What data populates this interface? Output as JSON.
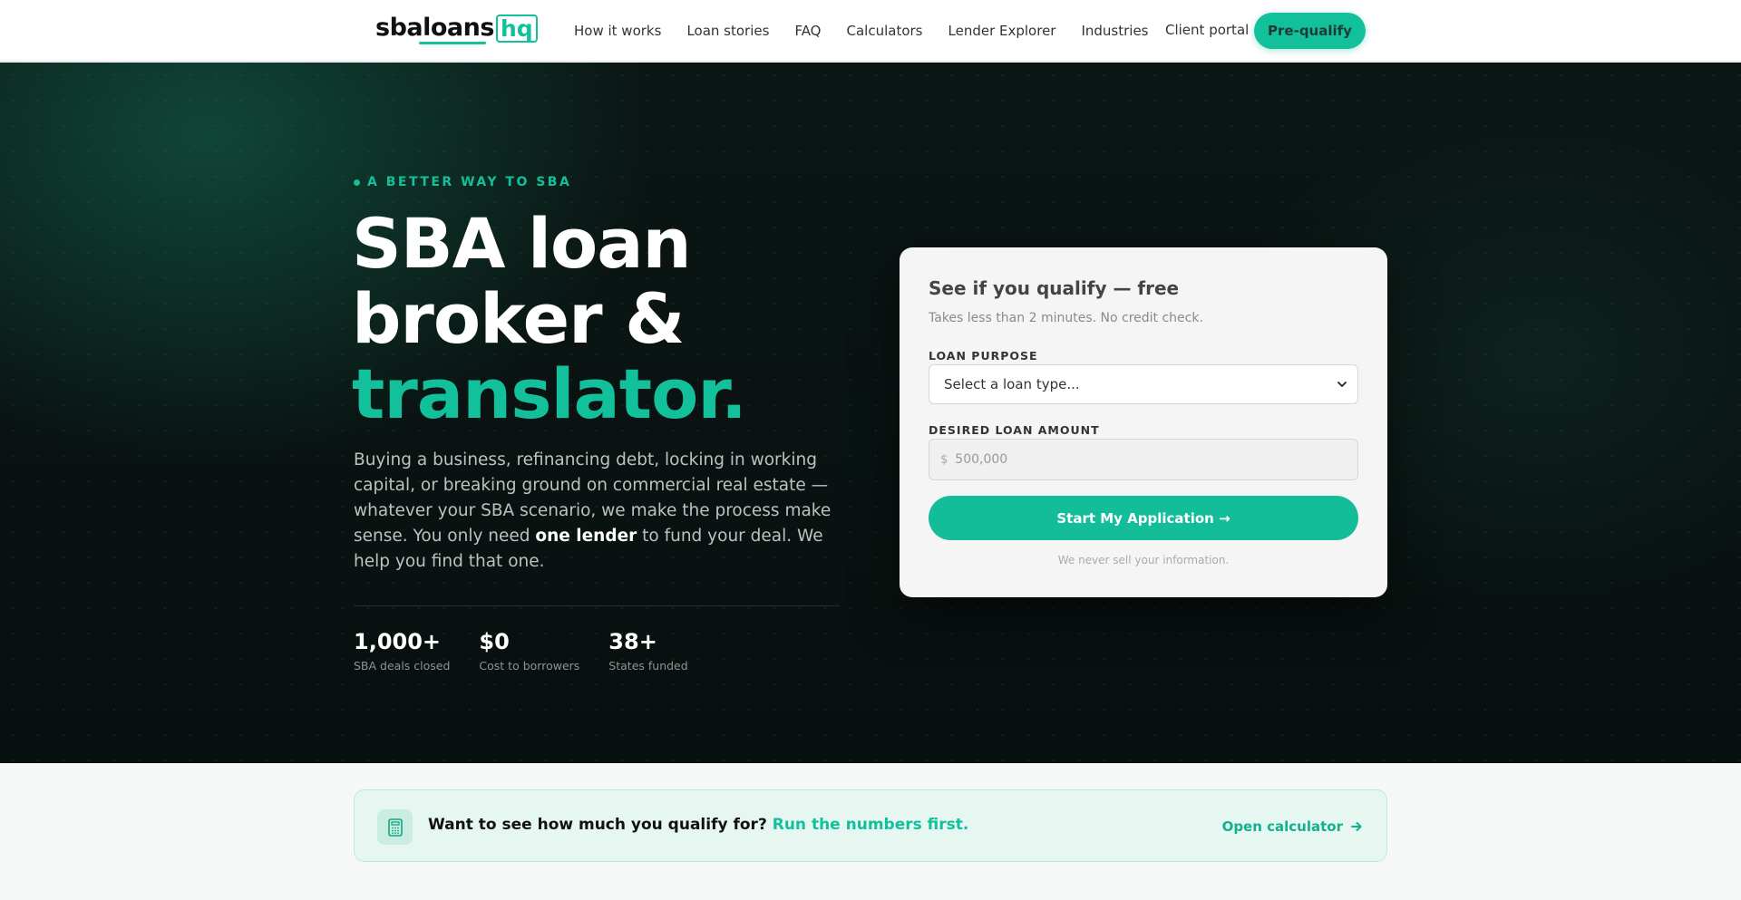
{
  "brand": {
    "name_main": "sbaloans",
    "name_hq": "hq",
    "accent": "#13c09c"
  },
  "nav": {
    "links": [
      "How it works",
      "Loan stories",
      "FAQ",
      "Calculators",
      "Lender Explorer",
      "Industries"
    ],
    "client_portal": "Client portal",
    "cta": "Pre-qualify"
  },
  "hero": {
    "eyebrow": "A BETTER WAY TO SBA",
    "headline_line1": "SBA loan",
    "headline_line2": "broker &",
    "headline_accent": "translator.",
    "desc_before": "Buying a business, refinancing debt, locking in working capital, or breaking ground on commercial real estate — whatever your SBA scenario, we make the process make sense. You only need ",
    "desc_bold": "one lender",
    "desc_after": " to fund your deal. We help you find that one.",
    "stats": [
      {
        "value": "1,000+",
        "label": "SBA deals closed"
      },
      {
        "value": "$0",
        "label": "Cost to borrowers"
      },
      {
        "value": "38+",
        "label": "States funded"
      }
    ]
  },
  "form": {
    "title": "See if you qualify — free",
    "subtitle": "Takes less than 2 minutes. No credit check.",
    "purpose_label": "LOAN PURPOSE",
    "purpose_selected": "Select a loan type...",
    "amount_label": "DESIRED LOAN AMOUNT",
    "amount_currency": "$",
    "amount_placeholder": "500,000",
    "submit": "Start My Application →",
    "privacy_note": "We never sell your information."
  },
  "banner": {
    "text": "Want to see how much you qualify for?",
    "accent_text": "Run the numbers first.",
    "link": "Open calculator",
    "icon": "calculator-icon"
  }
}
